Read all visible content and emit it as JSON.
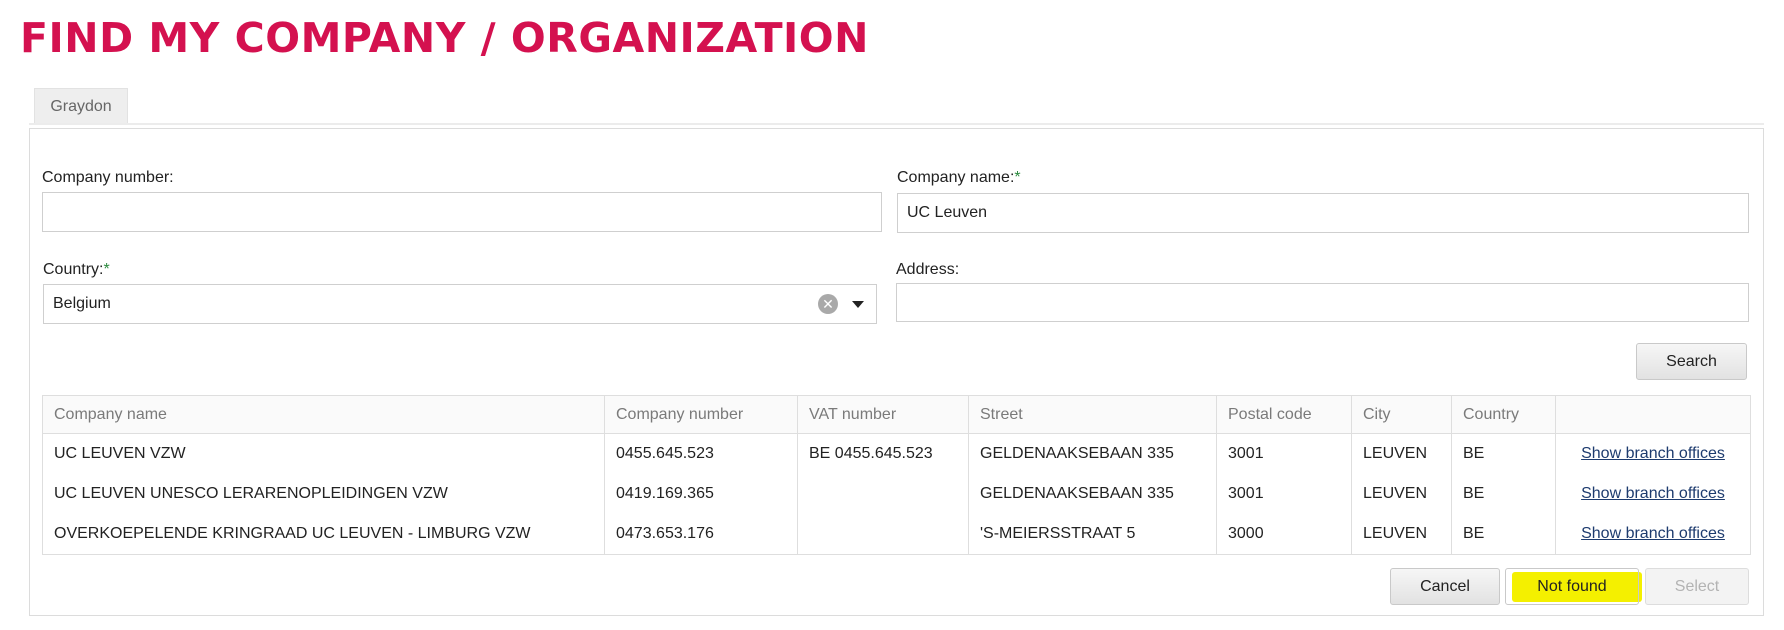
{
  "page": {
    "title": "FIND MY COMPANY / ORGANIZATION"
  },
  "tabs": [
    {
      "label": "Graydon",
      "active": true
    }
  ],
  "form": {
    "company_number": {
      "label": "Company number:",
      "value": ""
    },
    "company_name": {
      "label": "Company name:",
      "required_mark": "*",
      "value": "UC Leuven"
    },
    "country": {
      "label": "Country:",
      "required_mark": "*",
      "value": "Belgium"
    },
    "address": {
      "label": "Address:",
      "value": ""
    },
    "search_label": "Search"
  },
  "results": {
    "columns": [
      "Company name",
      "Company number",
      "VAT number",
      "Street",
      "Postal code",
      "City",
      "Country",
      ""
    ],
    "rows": [
      {
        "company_name": "UC LEUVEN VZW",
        "company_number": "0455.645.523",
        "vat_number": "BE 0455.645.523",
        "street": "GELDENAAKSEBAAN 335",
        "postal_code": "3001",
        "city": "LEUVEN",
        "country": "BE",
        "action": "Show branch offices"
      },
      {
        "company_name": "UC LEUVEN UNESCO LERARENOPLEIDINGEN VZW",
        "company_number": "0419.169.365",
        "vat_number": "",
        "street": "GELDENAAKSEBAAN 335",
        "postal_code": "3001",
        "city": "LEUVEN",
        "country": "BE",
        "action": "Show branch offices"
      },
      {
        "company_name": "OVERKOEPELENDE KRINGRAAD UC LEUVEN - LIMBURG VZW",
        "company_number": "0473.653.176",
        "vat_number": "",
        "street": "'S-MEIERSSTRAAT 5",
        "postal_code": "3000",
        "city": "LEUVEN",
        "country": "BE",
        "action": "Show branch offices"
      }
    ]
  },
  "footer": {
    "cancel_label": "Cancel",
    "not_found_label": "Not found",
    "select_label": "Select"
  },
  "colors": {
    "brand": "#d4114f",
    "highlight": "#f4f000",
    "link": "#1d3b6e",
    "required": "#2b8a3e"
  }
}
